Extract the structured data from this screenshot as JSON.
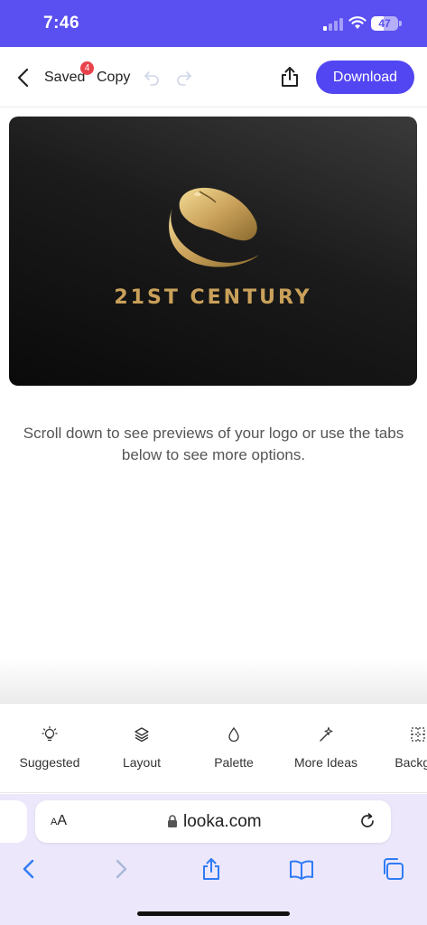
{
  "status_bar": {
    "time": "7:46",
    "battery_level": "47",
    "battery_fraction": 0.47
  },
  "toolbar": {
    "saved_label": "Saved",
    "saved_badge": "4",
    "copy_label": "Copy",
    "download_label": "Download"
  },
  "logo_preview": {
    "brand_text": "21ST CENTURY",
    "accent_color": "#caa15a",
    "background_color": "#111111",
    "mark_icon": "computer-mouse-icon"
  },
  "hint": {
    "text": "Scroll down to see previews of your logo or use the tabs below to see more options."
  },
  "tabs": [
    {
      "label": "Suggested",
      "icon": "lightbulb-icon"
    },
    {
      "label": "Layout",
      "icon": "layers-icon"
    },
    {
      "label": "Palette",
      "icon": "drop-icon"
    },
    {
      "label": "More Ideas",
      "icon": "magic-wand-icon"
    },
    {
      "label": "Backgro",
      "icon": "background-grid-icon"
    }
  ],
  "browser": {
    "text_size_label": "AA",
    "url": "looka.com"
  },
  "colors": {
    "brand_purple": "#5246f2",
    "status_bar": "#5a4ff0",
    "badge_red": "#e8434b",
    "browser_tint": "#ece7fb"
  }
}
